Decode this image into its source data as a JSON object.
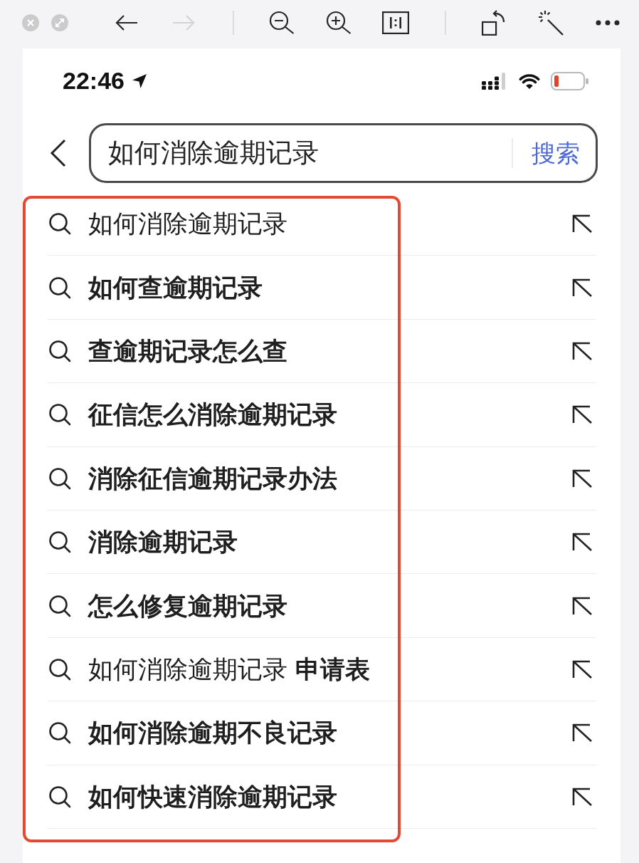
{
  "window_controls": [
    {
      "kind": "close"
    },
    {
      "kind": "resize"
    }
  ],
  "toolbar": {
    "groups": [
      {
        "buttons": [
          {
            "kind": "back",
            "disabled": false
          },
          {
            "kind": "forward",
            "disabled": true
          }
        ]
      },
      {
        "buttons": [
          {
            "kind": "zoom-out",
            "disabled": false
          },
          {
            "kind": "zoom-in",
            "disabled": false
          },
          {
            "kind": "actual-size",
            "disabled": false
          }
        ]
      },
      {
        "buttons": [
          {
            "kind": "rotate",
            "disabled": false
          },
          {
            "kind": "wand",
            "disabled": false
          },
          {
            "kind": "more",
            "disabled": false
          }
        ]
      }
    ]
  },
  "status_bar": {
    "time": "22:46"
  },
  "search": {
    "value": "如何消除逾期记录",
    "button": "搜索"
  },
  "suggestions": [
    {
      "text": "如何消除逾期记录",
      "bold": false
    },
    {
      "text": "如何查逾期记录",
      "bold": true
    },
    {
      "text": "查逾期记录怎么查",
      "bold": true
    },
    {
      "text": "征信怎么消除逾期记录",
      "bold": true
    },
    {
      "text": "消除征信逾期记录办法",
      "bold": true
    },
    {
      "text": "消除逾期记录",
      "bold": true
    },
    {
      "text": "怎么修复逾期记录",
      "bold": true
    },
    {
      "text": "如何消除逾期记录 **申请表**",
      "bold": false
    },
    {
      "text": "如何消除逾期不良记录",
      "bold": true
    },
    {
      "text": "如何快速消除逾期记录",
      "bold": true
    }
  ],
  "annotation": {
    "kind": "rectangle"
  }
}
